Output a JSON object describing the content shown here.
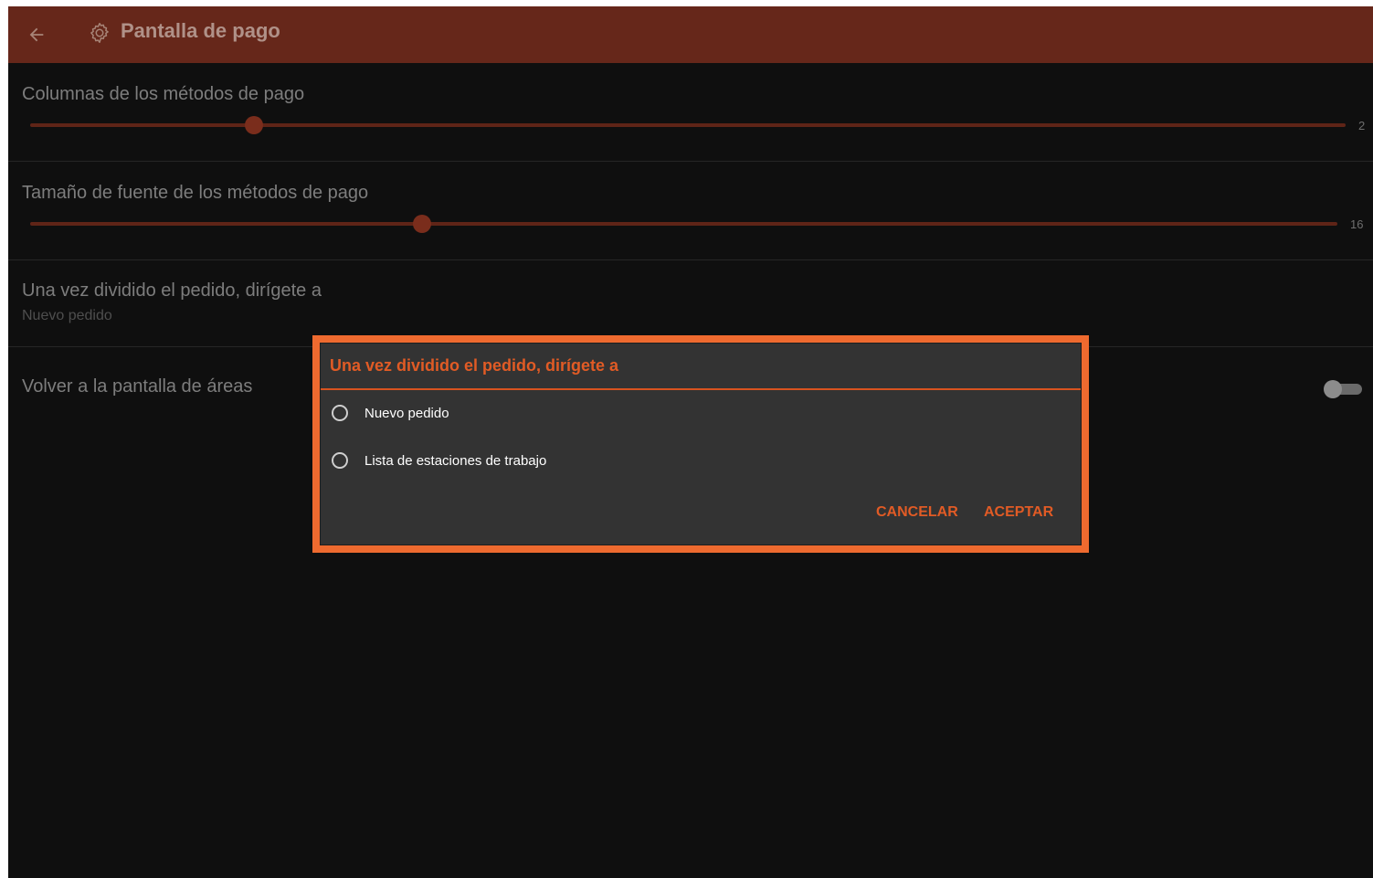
{
  "header": {
    "title": "Pantalla de pago",
    "back_icon": "arrow-left-icon",
    "settings_icon": "gear-icon"
  },
  "settings": {
    "columns": {
      "label": "Columnas de los métodos de pago",
      "value": "2",
      "fraction": 0.17
    },
    "font_size": {
      "label": "Tamaño de fuente de los métodos de pago",
      "value": "16",
      "fraction": 0.3
    },
    "after_split": {
      "label": "Una vez dividido el pedido, dirígete a",
      "current_value": "Nuevo pedido"
    },
    "return_areas": {
      "label": "Volver a la pantalla de áreas",
      "enabled": false
    }
  },
  "dialog": {
    "title": "Una vez dividido el pedido, dirígete a",
    "options": [
      {
        "label": "Nuevo pedido",
        "selected": false
      },
      {
        "label": "Lista de estaciones de trabajo",
        "selected": false
      }
    ],
    "cancel_label": "CANCELAR",
    "accept_label": "ACEPTAR",
    "accent_color": "#ee6a2f"
  }
}
